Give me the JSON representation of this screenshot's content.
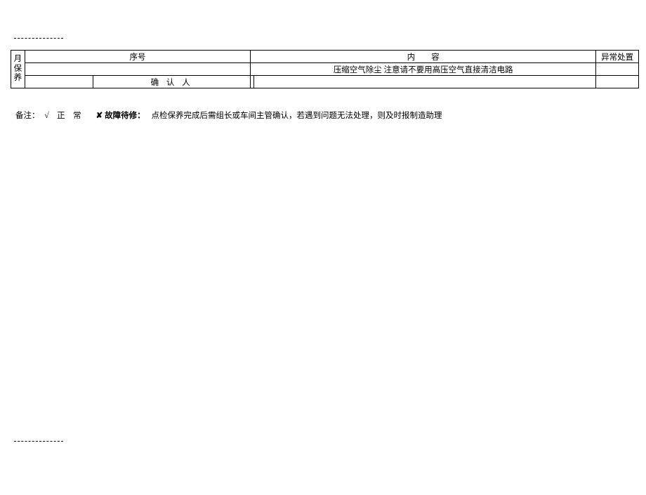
{
  "table": {
    "vertical_label": "月保养",
    "header": {
      "seq": "序号",
      "content": "内　　容",
      "abnormal": "异常处置"
    },
    "row1": {
      "content": "压缩空气除尘  注意请不要用高压空气直接清洁电路"
    },
    "row2": {
      "label": "确  认  人"
    }
  },
  "remark": {
    "prefix": "备注：",
    "normal": "√　正　常",
    "fault": "✘ 故障待修：",
    "text": "点检保养完成后需组长或车间主管确认，若遇到问题无法处理，则及时报制造助理"
  }
}
